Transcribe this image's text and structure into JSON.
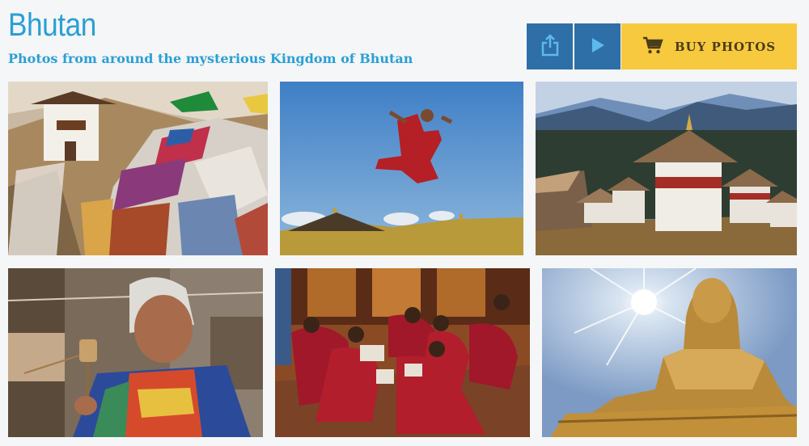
{
  "header": {
    "title": "Bhutan",
    "subtitle": "Photos from around the mysterious Kingdom of Bhutan"
  },
  "toolbar": {
    "share_icon": "share-icon",
    "play_icon": "play-icon",
    "buy_label": "BUY PHOTOS",
    "buy_icon": "cart-icon"
  },
  "colors": {
    "accent": "#2a9fd6",
    "button_blue": "#2f6fa8",
    "buy_yellow": "#f7c93e"
  },
  "gallery": {
    "photos": [
      {
        "subject": "prayer-flags-and-dzong"
      },
      {
        "subject": "monk-jumping"
      },
      {
        "subject": "chortens-at-pass"
      },
      {
        "subject": "woman-with-prayer-wheel"
      },
      {
        "subject": "monks-studying"
      },
      {
        "subject": "golden-buddha-statue"
      }
    ]
  }
}
